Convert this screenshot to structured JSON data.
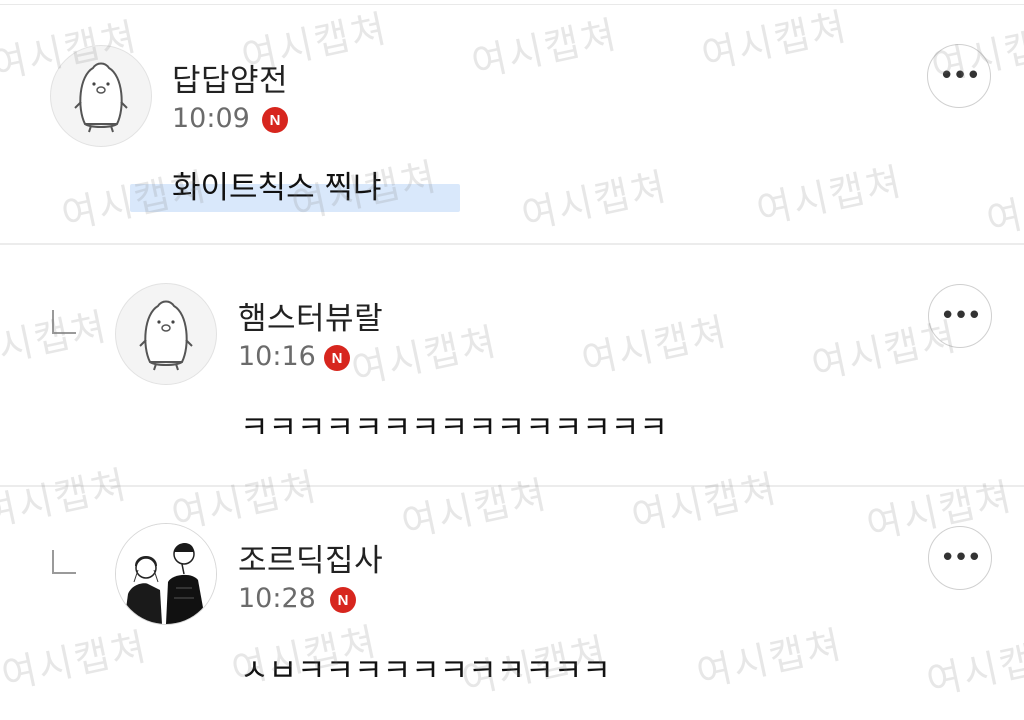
{
  "comments": [
    {
      "nickname": "답답얌전",
      "time": "10:09",
      "badge": "N",
      "text": "화이트칙스 찍냐",
      "more": "•••",
      "avatar_icon": "penguin-icon"
    },
    {
      "nickname": "햄스터뷰랄",
      "time": "10:16",
      "badge": "N",
      "text": "ㅋㅋㅋㅋㅋㅋㅋㅋㅋㅋㅋㅋㅋㅋㅋ",
      "more": "•••",
      "avatar_icon": "penguin-icon"
    },
    {
      "nickname": "조르딕집사",
      "time": "10:28",
      "badge": "N",
      "text": "ㅅㅂㅋㅋㅋㅋㅋㅋㅋㅋㅋㅋㅋ",
      "more": "•••",
      "avatar_icon": "manga-characters-icon"
    }
  ],
  "watermark": "여시캡쳐",
  "colors": {
    "badge": "#d7261e",
    "highlight": "#d9e8fb",
    "divider": "#ececec"
  }
}
